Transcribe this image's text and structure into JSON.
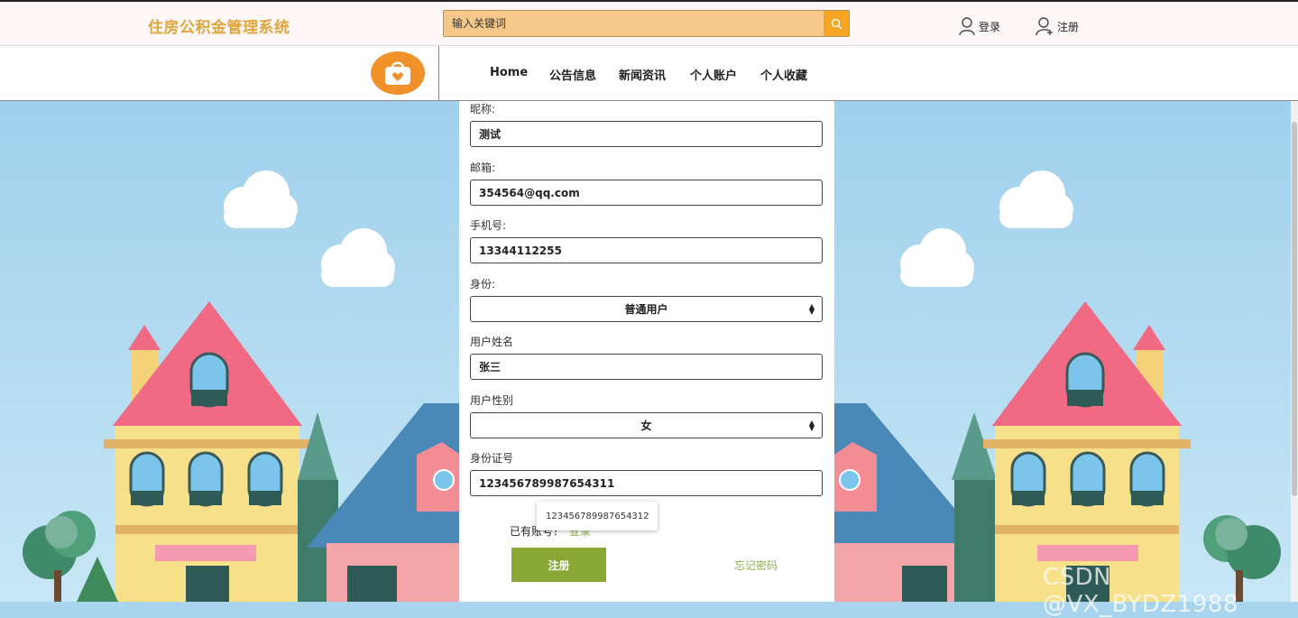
{
  "header": {
    "site_title": "住房公积金管理系统",
    "search": {
      "placeholder": "输入关键词",
      "button_icon": "search-icon"
    },
    "login_label": "登录",
    "register_label": "注册"
  },
  "nav": {
    "items": [
      {
        "label": "Home"
      },
      {
        "label": "公告信息"
      },
      {
        "label": "新闻资讯"
      },
      {
        "label": "个人账户"
      },
      {
        "label": "个人收藏"
      }
    ]
  },
  "form": {
    "nickname": {
      "label": "昵称:",
      "value": "测试"
    },
    "email": {
      "label": "邮箱:",
      "value": "354564@qq.com"
    },
    "phone": {
      "label": "手机号:",
      "value": "13344112255"
    },
    "identity": {
      "label": "身份:",
      "value": "普通用户"
    },
    "name": {
      "label": "用户姓名",
      "value": "张三"
    },
    "gender": {
      "label": "用户性别",
      "value": "女"
    },
    "id_number": {
      "label": "身份证号",
      "value": "123456789987654311"
    },
    "autocomplete_suggestion": "123456789987654312",
    "login_hint": "已有账号？",
    "login_link": "登录",
    "register_button": "注册",
    "forgot_password": "忘记密码"
  },
  "watermark": "CSDN @VX_BYDZ1988",
  "colors": {
    "title": "#e0a53c",
    "search_bg": "#f6c98a",
    "search_button": "#f5a623",
    "logo": "#f0912a",
    "register_button": "#8aa735",
    "link_green": "#8ab04c",
    "sky": "#a8d4ee"
  }
}
